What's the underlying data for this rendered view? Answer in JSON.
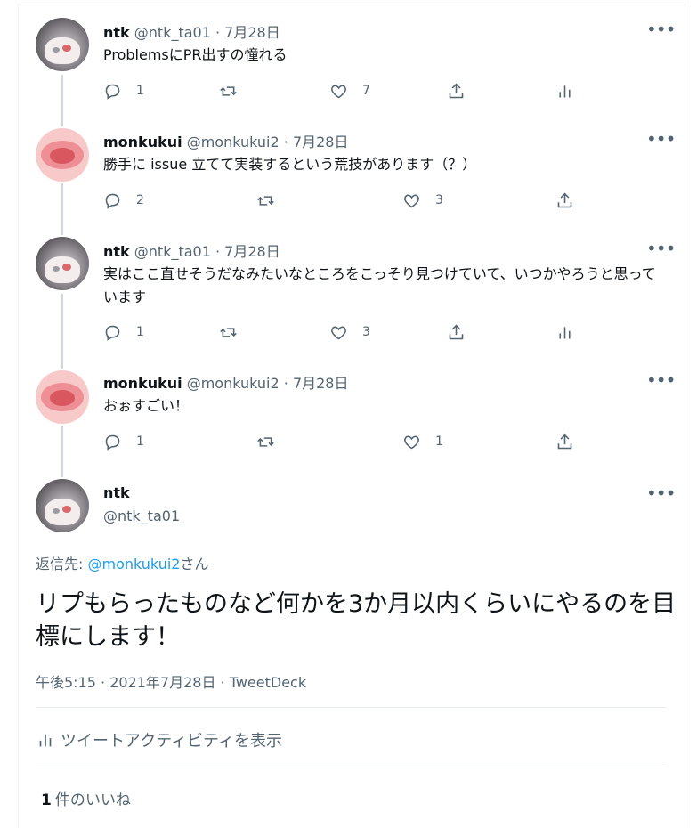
{
  "tweets": [
    {
      "name": "ntk",
      "handle": "@ntk_ta01",
      "date": "· 7月28日",
      "text": "ProblemsにPR出すの憧れる",
      "replies": "1",
      "likes": "7",
      "avatar": "ntk",
      "analytics": true
    },
    {
      "name": "monkukui",
      "handle": "@monkukui2",
      "date": "· 7月28日",
      "text": "勝手に issue 立てて実装するという荒技があります（？）",
      "replies": "2",
      "likes": "3",
      "avatar": "pig",
      "analytics": false
    },
    {
      "name": "ntk",
      "handle": "@ntk_ta01",
      "date": "· 7月28日",
      "text": "実はここ直せそうだなみたいなところをこっそり見つけていて、いつかやろうと思っています",
      "replies": "1",
      "likes": "3",
      "avatar": "ntk",
      "analytics": true
    },
    {
      "name": "monkukui",
      "handle": "@monkukui2",
      "date": "· 7月28日",
      "text": "おぉすごい！",
      "replies": "1",
      "likes": "1",
      "avatar": "pig",
      "analytics": false
    }
  ],
  "main": {
    "name": "ntk",
    "handle": "@ntk_ta01",
    "reply_prefix": "返信先: ",
    "reply_handle": "@monkukui2",
    "reply_suffix": "さん",
    "text": "リプもらったものなど何かを3か月以内くらいにやるのを目標にします！",
    "timestamp": "午後5:15 · 2021年7月28日 · TweetDeck",
    "activity_label": "ツイートアクティビティを表示",
    "likes_count": "1",
    "likes_label": "件のいいね"
  },
  "icons": {
    "more": "more-icon",
    "reply": "reply-icon",
    "retweet": "retweet-icon",
    "like": "like-icon",
    "share": "share-icon",
    "analytics": "analytics-icon"
  },
  "colors": {
    "link": "#1d9bf0",
    "muted": "#536471",
    "text": "#0f1419",
    "line": "#cfd9de"
  }
}
